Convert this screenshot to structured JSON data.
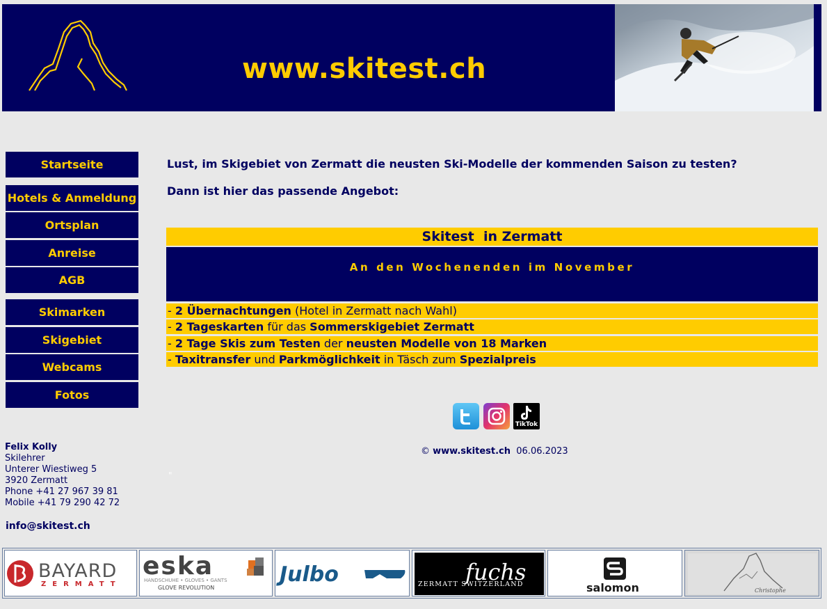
{
  "header": {
    "site_title": "www.skitest.ch",
    "brand_color": "#000060",
    "accent_color": "#ffcc00"
  },
  "nav": {
    "items": [
      {
        "label": "Startseite"
      },
      {
        "label": "Hotels & Anmeldung"
      },
      {
        "label": "Ortsplan"
      },
      {
        "label": "Anreise"
      },
      {
        "label": "AGB"
      },
      {
        "label": "Skimarken"
      },
      {
        "label": "Skigebiet"
      },
      {
        "label": "Webcams"
      },
      {
        "label": "Fotos"
      }
    ]
  },
  "contact": {
    "name": "Felix Kolly",
    "role": "Skilehrer",
    "street": "Unterer Wiestiweg 5",
    "city": "3920 Zermatt",
    "phone": "Phone +41 27 967 39 81",
    "mobile": "Mobile +41 79 290 42 72",
    "email": "info@skitest.ch"
  },
  "main": {
    "intro_question": "Lust, im Skigebiet von Zermatt die neusten Ski-Modelle der kommenden Saison zu testen?",
    "intro_offer": "Dann ist hier das passende Angebot:",
    "offer_title": "Skitest  in Zermatt",
    "offer_subtitle": "An den Wochenenden im November",
    "features": [
      {
        "parts": [
          "- ",
          "2 Übernachtungen",
          " (Hotel in Zermatt nach Wahl)"
        ]
      },
      {
        "parts": [
          "- ",
          "2 Tageskarten",
          " für das ",
          "Sommerskigebiet Zermatt"
        ]
      },
      {
        "parts": [
          "- ",
          "2 Tage Skis zum Testen",
          " der ",
          "neusten Modelle von 18 Marken"
        ]
      },
      {
        "parts": [
          "- ",
          "Taxitransfer",
          " und ",
          "Parkmöglichkeit",
          " in Täsch zum ",
          "Spezialpreis"
        ]
      }
    ],
    "social_icons": [
      "twitter-icon",
      "instagram-icon",
      "tiktok-icon"
    ],
    "tiktok_label": "TikTok",
    "copyright_symbol": "©",
    "copyright_site": "www.skitest.ch",
    "copyright_date": "06.06.2023",
    "stray_mark": "\""
  },
  "sponsors": [
    {
      "name": "BAYARD",
      "sub": "ZERMATT"
    },
    {
      "name": "eska",
      "sub": "HANDSCHUHE • GLOVES • GANTS",
      "tag": "GLOVE REVOLUTION"
    },
    {
      "name": "Julbo"
    },
    {
      "name": "fuchs",
      "sub": "ZERMATT SWITZERLAND"
    },
    {
      "name": "salomon"
    },
    {
      "name": "Christophe"
    }
  ]
}
